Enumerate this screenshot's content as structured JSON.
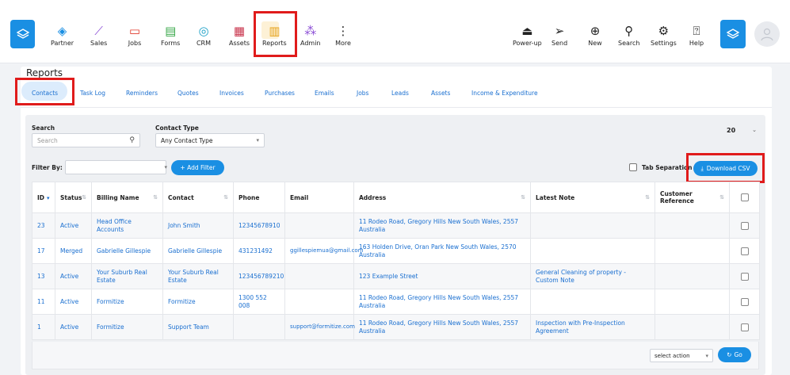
{
  "nav": {
    "items": [
      {
        "label": "Partner",
        "icon": "handshake-icon"
      },
      {
        "label": "Sales",
        "icon": "sales-chart-icon"
      },
      {
        "label": "Jobs",
        "icon": "briefcase-icon"
      },
      {
        "label": "Forms",
        "icon": "form-icon"
      },
      {
        "label": "CRM",
        "icon": "user-circle-icon"
      },
      {
        "label": "Assets",
        "icon": "grid-icon"
      },
      {
        "label": "Reports",
        "icon": "report-chart-icon"
      },
      {
        "label": "Admin",
        "icon": "team-icon"
      },
      {
        "label": "More",
        "icon": "more-vertical-icon"
      }
    ],
    "right_items": [
      {
        "label": "Power-up",
        "icon": "power-up-icon"
      },
      {
        "label": "Send",
        "icon": "send-icon"
      },
      {
        "label": "New",
        "icon": "plus-circle-icon"
      },
      {
        "label": "Search",
        "icon": "search-icon"
      },
      {
        "label": "Settings",
        "icon": "gear-icon"
      },
      {
        "label": "Help",
        "icon": "help-icon"
      }
    ],
    "active": "Reports",
    "accent": "#1a8fe3"
  },
  "page": {
    "title": "Reports",
    "tabs": [
      "Contacts",
      "Task Log",
      "Reminders",
      "Quotes",
      "Invoices",
      "Purchases",
      "Emails",
      "Jobs",
      "Leads",
      "Assets",
      "Income & Expenditure"
    ],
    "active_tab": "Contacts"
  },
  "filters": {
    "search_label": "Search",
    "search_placeholder": "Search",
    "contact_type_label": "Contact Type",
    "contact_type_value": "Any Contact Type",
    "per_page": "20",
    "filter_by_label": "Filter By:",
    "add_filter_label": "+ Add Filter",
    "tab_separation_label": "Tab Separation",
    "download_label": "Download CSV"
  },
  "table": {
    "columns": [
      "ID",
      "Status",
      "Billing Name",
      "Contact",
      "Phone",
      "Email",
      "Address",
      "Latest Note",
      "Customer Reference"
    ],
    "rows": [
      {
        "id": "23",
        "status": "Active",
        "billing": "Head Office Accounts",
        "contact": "John Smith",
        "phone": "12345678910",
        "email": "",
        "address": "11 Rodeo Road, Gregory Hills New South Wales, 2557 Australia",
        "note": "",
        "ref": ""
      },
      {
        "id": "17",
        "status": "Merged",
        "billing": "Gabrielle Gillespie",
        "contact": "Gabrielle Gillespie",
        "phone": "431231492",
        "email": "ggillespiemua@gmail.com",
        "address": "163 Holden Drive, Oran Park New South Wales, 2570 Australia",
        "note": "",
        "ref": ""
      },
      {
        "id": "13",
        "status": "Active",
        "billing": "Your Suburb Real Estate",
        "contact": "Your Suburb Real Estate",
        "phone": "123456789210",
        "email": "",
        "address": "123 Example Street",
        "note": "General Cleaning of property - Custom Note",
        "ref": ""
      },
      {
        "id": "11",
        "status": "Active",
        "billing": "Formitize",
        "contact": "Formitize",
        "phone": "1300 552 008",
        "email": "",
        "address": "11 Rodeo Road, Gregory Hills New South Wales, 2557 Australia",
        "note": "",
        "ref": ""
      },
      {
        "id": "1",
        "status": "Active",
        "billing": "Formitize",
        "contact": "Support Team",
        "phone": "",
        "email": "support@formitize.com",
        "address": "11 Rodeo Road, Gregory Hills New South Wales, 2557 Australia",
        "note": "Inspection with Pre-Inspection Agreement",
        "ref": ""
      }
    ]
  },
  "footer": {
    "action_placeholder": "select action",
    "go_label": "Go"
  }
}
